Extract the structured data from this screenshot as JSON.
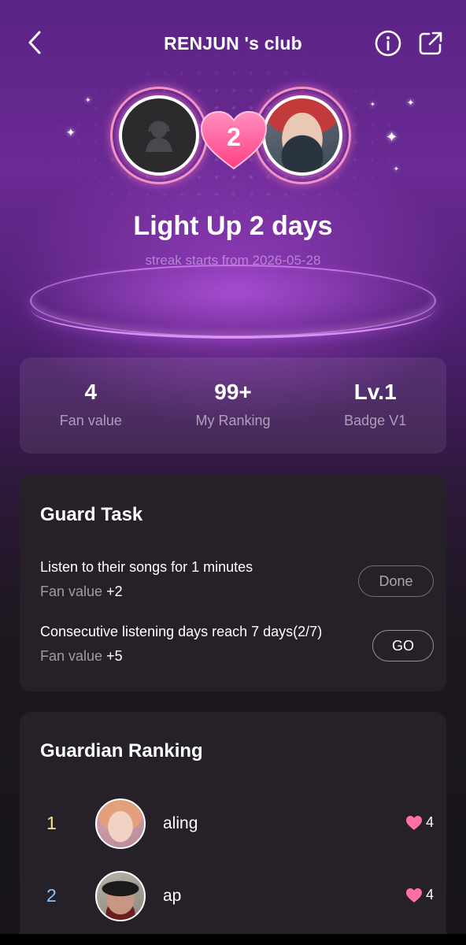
{
  "header": {
    "title": "RENJUN 's club",
    "back_icon": "chevron-left-icon",
    "info_icon": "info-icon",
    "share_icon": "share-icon"
  },
  "hero": {
    "streak_count": "2",
    "title": "Light Up 2 days",
    "subtitle": "streak starts from 2026-05-28",
    "heart_color": "#ff5f9e",
    "ring_color": "#f493c2"
  },
  "stats": [
    {
      "value": "4",
      "label": "Fan value"
    },
    {
      "value": "99+",
      "label": "My Ranking"
    },
    {
      "value": "Lv.1",
      "label": "Badge V1"
    }
  ],
  "guard_task": {
    "title": "Guard Task",
    "tasks": [
      {
        "name": "Listen to their songs for 1 minutes",
        "reward_label": "Fan value",
        "reward_value": "+2",
        "button": "Done"
      },
      {
        "name": "Consecutive listening days reach 7 days(2/7)",
        "reward_label": "Fan value",
        "reward_value": "+5",
        "button": "GO"
      }
    ]
  },
  "guardian_ranking": {
    "title": "Guardian Ranking",
    "rows": [
      {
        "rank": "1",
        "name": "aling",
        "score": "4",
        "rank_color": "#f3e98a"
      },
      {
        "rank": "2",
        "name": "ap",
        "score": "4",
        "rank_color": "#8fc2f0"
      }
    ],
    "heart_icon_color": "#ff6fa8"
  }
}
